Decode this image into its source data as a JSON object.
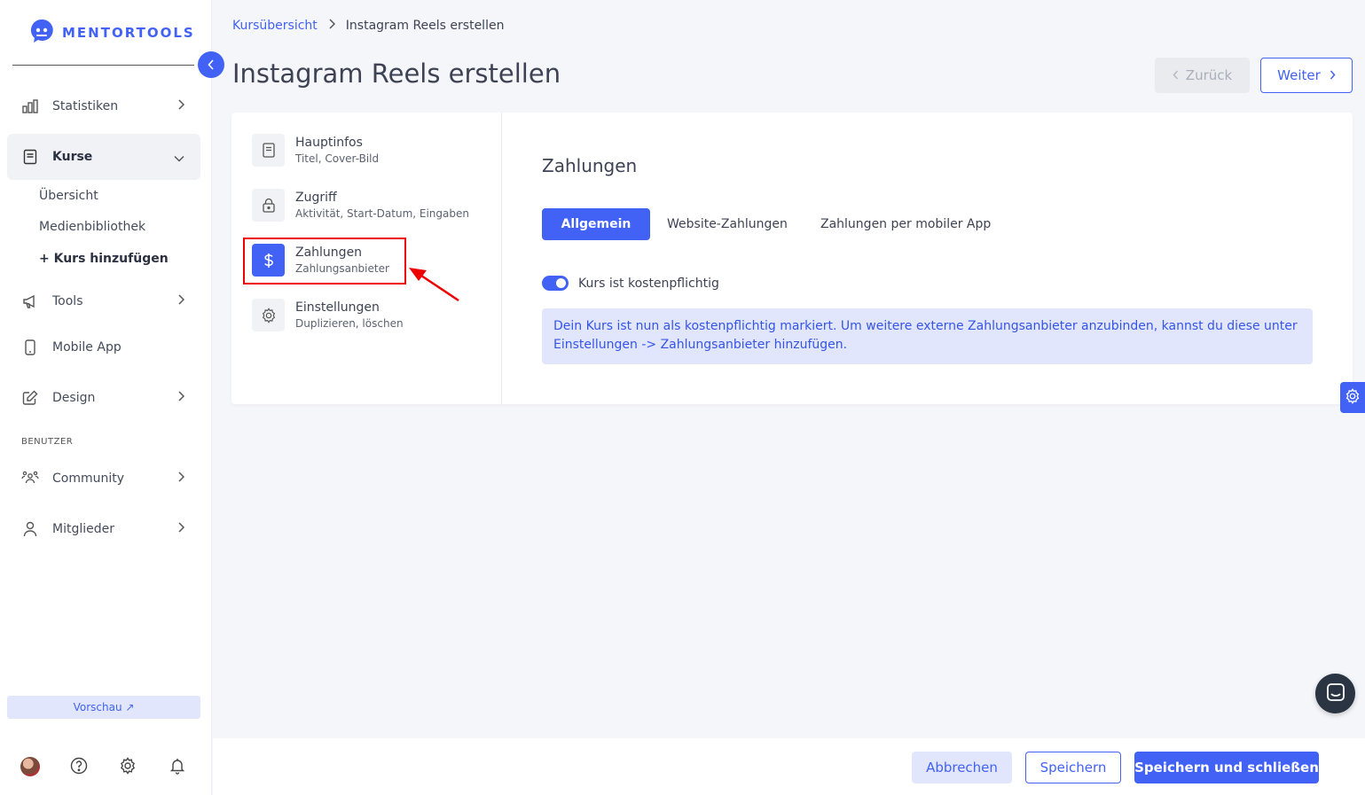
{
  "app": {
    "logo_text": "MENTORTOOLS"
  },
  "sidebar": {
    "items": [
      {
        "label": "Statistiken"
      },
      {
        "label": "Kurse"
      },
      {
        "label": "Tools"
      },
      {
        "label": "Mobile App"
      },
      {
        "label": "Design"
      }
    ],
    "kurse_sub": [
      "Übersicht",
      "Medienbibliothek",
      "+ Kurs hinzufügen"
    ],
    "section_label": "BENUTZER",
    "user_items": [
      {
        "label": "Community"
      },
      {
        "label": "Mitglieder"
      }
    ],
    "preview_label": "Vorschau ↗"
  },
  "breadcrumb": {
    "parent": "Kursübersicht",
    "current": "Instagram Reels erstellen"
  },
  "page": {
    "title": "Instagram Reels erstellen"
  },
  "header_buttons": {
    "back": "Zurück",
    "next": "Weiter"
  },
  "steps": [
    {
      "title": "Hauptinfos",
      "subtitle": "Titel, Cover-Bild"
    },
    {
      "title": "Zugriff",
      "subtitle": "Aktivität, Start-Datum, Eingaben"
    },
    {
      "title": "Zahlungen",
      "subtitle": "Zahlungsanbieter"
    },
    {
      "title": "Einstellungen",
      "subtitle": "Duplizieren, löschen"
    }
  ],
  "content": {
    "section_title": "Zahlungen",
    "tabs": [
      "Allgemein",
      "Website-Zahlungen",
      "Zahlungen per mobiler App"
    ],
    "toggle_label": "Kurs ist kostenpflichtig",
    "info_text": "Dein Kurs ist nun als kostenpflichtig markiert. Um weitere externe Zahlungsanbieter anzubinden, kannst du diese unter Einstellungen -> Zahlungsanbieter hinzufügen."
  },
  "footer": {
    "cancel": "Abbrechen",
    "save": "Speichern",
    "save_close": "Speichern und schließen"
  },
  "colors": {
    "accent": "#4162f5",
    "highlight": "#e00000",
    "info_bg": "#e2e6fd"
  }
}
